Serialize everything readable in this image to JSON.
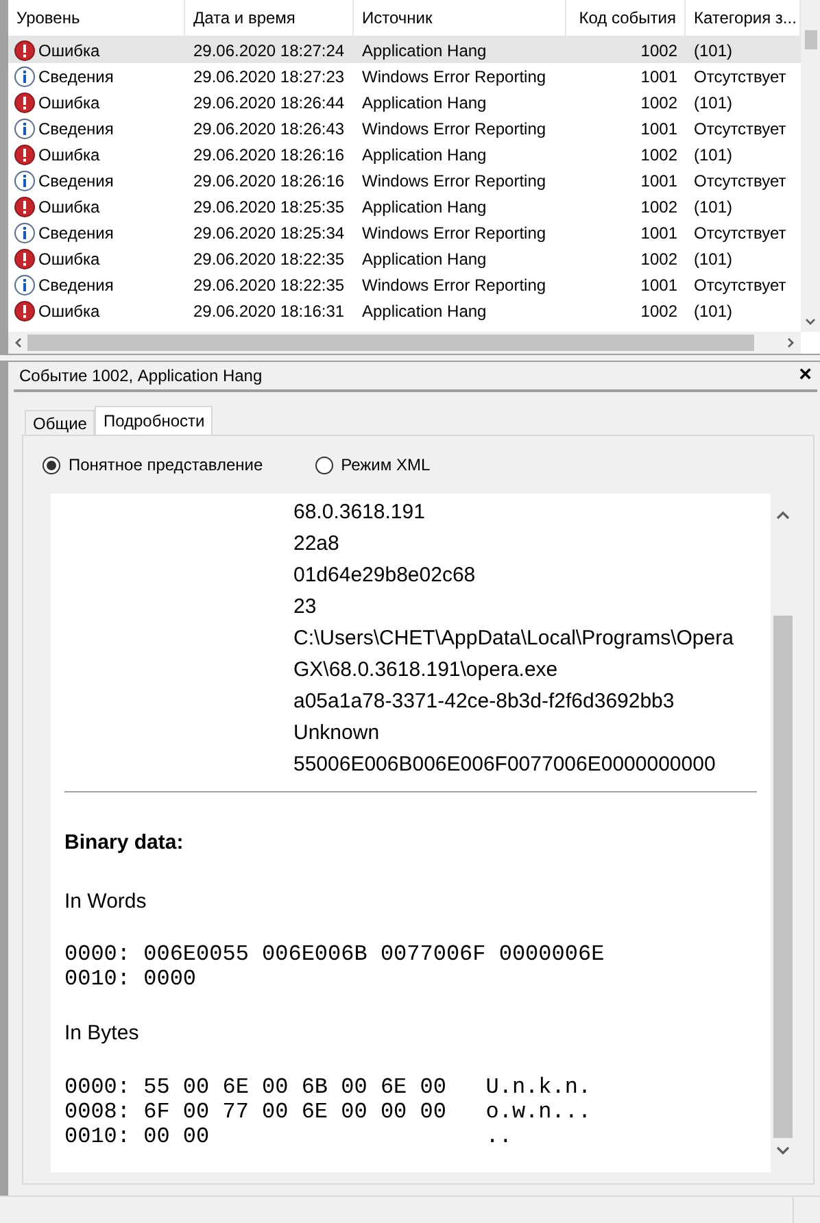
{
  "table": {
    "columns": [
      "Уровень",
      "Дата и время",
      "Источник",
      "Код события",
      "Категория з..."
    ],
    "rows": [
      {
        "kind": "error",
        "selected": true,
        "cells": [
          "Ошибка",
          "29.06.2020 18:27:24",
          "Application Hang",
          "1002",
          "(101)"
        ]
      },
      {
        "kind": "info",
        "selected": false,
        "cells": [
          "Сведения",
          "29.06.2020 18:27:23",
          "Windows Error Reporting",
          "1001",
          "Отсутствует"
        ]
      },
      {
        "kind": "error",
        "selected": false,
        "cells": [
          "Ошибка",
          "29.06.2020 18:26:44",
          "Application Hang",
          "1002",
          "(101)"
        ]
      },
      {
        "kind": "info",
        "selected": false,
        "cells": [
          "Сведения",
          "29.06.2020 18:26:43",
          "Windows Error Reporting",
          "1001",
          "Отсутствует"
        ]
      },
      {
        "kind": "error",
        "selected": false,
        "cells": [
          "Ошибка",
          "29.06.2020 18:26:16",
          "Application Hang",
          "1002",
          "(101)"
        ]
      },
      {
        "kind": "info",
        "selected": false,
        "cells": [
          "Сведения",
          "29.06.2020 18:26:16",
          "Windows Error Reporting",
          "1001",
          "Отсутствует"
        ]
      },
      {
        "kind": "error",
        "selected": false,
        "cells": [
          "Ошибка",
          "29.06.2020 18:25:35",
          "Application Hang",
          "1002",
          "(101)"
        ]
      },
      {
        "kind": "info",
        "selected": false,
        "cells": [
          "Сведения",
          "29.06.2020 18:25:34",
          "Windows Error Reporting",
          "1001",
          "Отсутствует"
        ]
      },
      {
        "kind": "error",
        "selected": false,
        "cells": [
          "Ошибка",
          "29.06.2020 18:22:35",
          "Application Hang",
          "1002",
          "(101)"
        ]
      },
      {
        "kind": "info",
        "selected": false,
        "cells": [
          "Сведения",
          "29.06.2020 18:22:35",
          "Windows Error Reporting",
          "1001",
          "Отсутствует"
        ]
      },
      {
        "kind": "error",
        "selected": false,
        "cells": [
          "Ошибка",
          "29.06.2020 18:16:31",
          "Application Hang",
          "1002",
          "(101)"
        ]
      }
    ]
  },
  "details": {
    "title": "Событие 1002, Application Hang",
    "close_glyph": "×",
    "tabs": [
      {
        "label": "Общие",
        "selected": false
      },
      {
        "label": "Подробности",
        "selected": true
      }
    ],
    "view_modes": [
      {
        "label": "Понятное представление",
        "selected": true
      },
      {
        "label": "Режим XML",
        "selected": false
      }
    ],
    "values": [
      "68.0.3618.191",
      "22a8",
      "01d64e29b8e02c68",
      "23",
      "C:\\Users\\CHET\\AppData\\Local\\Programs\\Opera GX\\68.0.3618.191\\opera.exe",
      "a05a1a78-3371-42ce-8b3d-f2f6d3692bb3",
      "Unknown",
      "55006E006B006E006F0077006E0000000000"
    ],
    "binary": {
      "heading": "Binary data:",
      "words_label": "In Words",
      "words_lines": [
        "0000: 006E0055 006E006B 0077006F 0000006E",
        "0010: 0000"
      ],
      "bytes_label": "In Bytes",
      "bytes_lines": [
        "0000: 55 00 6E 00 6B 00 6E 00   U.n.k.n.",
        "0008: 6F 00 77 00 6E 00 00 00   o.w.n...",
        "0010: 00 00                     .."
      ]
    }
  }
}
